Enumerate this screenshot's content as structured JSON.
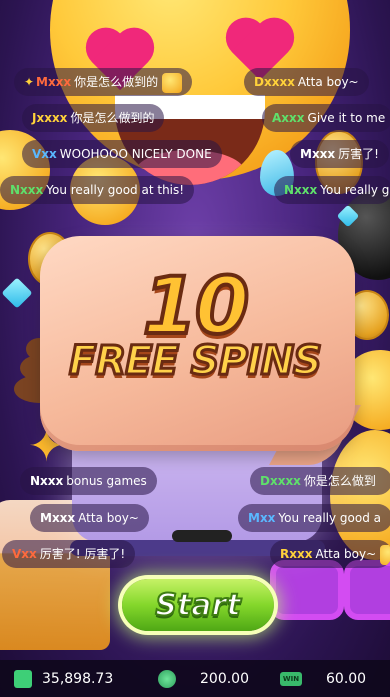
{
  "bonus": {
    "count": "10",
    "title": "FREE SPINS",
    "start_label": "Start"
  },
  "chat": [
    {
      "name": "Mxxx",
      "text": "你是怎么做到的",
      "name_color": "#ff6a3d"
    },
    {
      "name": "Dxxxx",
      "text": "Atta boy~",
      "name_color": "#ffd23a"
    },
    {
      "name": "Jxxxx",
      "text": "你是怎么做到的",
      "name_color": "#ffd23a"
    },
    {
      "name": "Axxx",
      "text": "Give it to me",
      "name_color": "#5fe06b"
    },
    {
      "name": "Vxx",
      "text": "WOOHOOO NICELY DONE",
      "name_color": "#5ab8ff"
    },
    {
      "name": "Mxxx",
      "text": "厉害了!",
      "name_color": "#ffffff"
    },
    {
      "name": "Nxxx",
      "text": "You really good at this!",
      "name_color": "#5fe06b"
    },
    {
      "name": "Nxxx",
      "text": "You really g",
      "name_color": "#5fe06b"
    },
    {
      "name": "Nxxx",
      "text": "bonus games",
      "name_color": "#ffffff"
    },
    {
      "name": "Dxxxx",
      "text": "你是怎么做到",
      "name_color": "#5fe06b"
    },
    {
      "name": "Mxxx",
      "text": "Atta boy~",
      "name_color": "#ffffff"
    },
    {
      "name": "Mxx",
      "text": "You really good a",
      "name_color": "#5ab8ff"
    },
    {
      "name": "Vxx",
      "text": "厉害了! 厉害了!",
      "name_color": "#ff6a3d"
    },
    {
      "name": "Rxxx",
      "text": "Atta boy~",
      "name_color": "#ffd23a"
    }
  ],
  "status": {
    "balance": "35,898.73",
    "bet": "200.00",
    "win": "60.00",
    "win_icon_label": "WIN"
  },
  "icons": {
    "balance": "wallet-icon",
    "bet": "coin-stack-icon",
    "win": "win-icon"
  },
  "colors": {
    "start_button": "#84d72b",
    "bubble": "#f6b99b",
    "title_fill": "#ffc233",
    "status_icon": "#3ecf77"
  }
}
